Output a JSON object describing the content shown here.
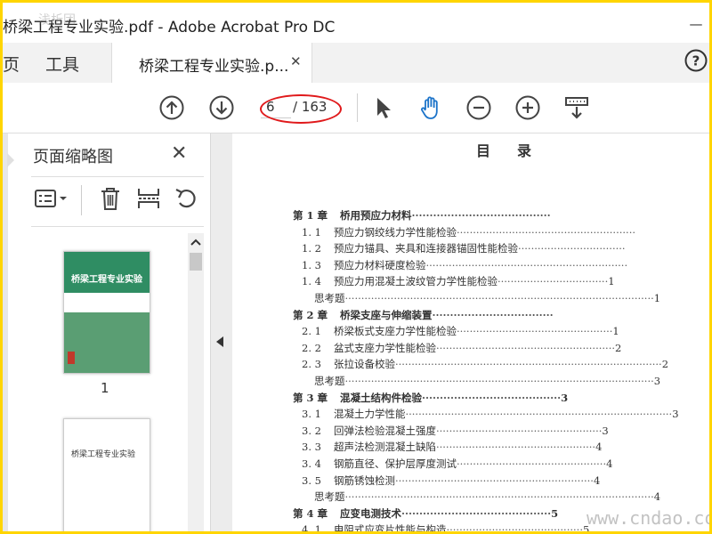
{
  "window": {
    "title": "桥梁工程专业实验.pdf - Adobe Acrobat Pro DC",
    "minimize_glyph": "—",
    "watermark_top": "浅析团"
  },
  "tabs": {
    "home": "页",
    "tools": "工具",
    "document": "桥梁工程专业实验.p...",
    "close_glyph": "✕"
  },
  "toolbar": {
    "current_page": "6",
    "page_total": "/ 163",
    "icons": [
      "up-arrow-icon",
      "down-arrow-icon",
      "select-cursor-icon",
      "hand-tool-icon",
      "zoom-out-icon",
      "zoom-in-icon",
      "read-mode-icon"
    ]
  },
  "sidebar": {
    "title": "页面缩略图",
    "close_glyph": "✕",
    "thumbnails": [
      {
        "page_label": "1",
        "cover_title": "桥梁工程专业实验"
      },
      {
        "cover_title": "桥梁工程专业实验"
      }
    ]
  },
  "document": {
    "heading": "目录",
    "toc": [
      {
        "type": "chapter",
        "num": "第 1 章",
        "title": "桥用预应力材料",
        "leader": "·······································",
        "page": ""
      },
      {
        "type": "sub",
        "num": "1. 1",
        "title": "预应力钢绞线力学性能检验",
        "leader": "·······················································",
        "page": ""
      },
      {
        "type": "sub",
        "num": "1. 2",
        "title": "预应力锚具、夹具和连接器锚固性能检验",
        "leader": "·································",
        "page": ""
      },
      {
        "type": "sub",
        "num": "1. 3",
        "title": "预应力材料硬度检验",
        "leader": "······························································",
        "page": ""
      },
      {
        "type": "sub",
        "num": "1. 4",
        "title": "预应力用混凝土波纹管力学性能检验",
        "leader": "··································",
        "page": "1"
      },
      {
        "type": "sub",
        "num": "",
        "title": "思考题",
        "leader": "·······························································································",
        "page": "1"
      },
      {
        "type": "chapter",
        "num": "第 2 章",
        "title": "桥梁支座与伸缩装置",
        "leader": "··································",
        "page": ""
      },
      {
        "type": "sub",
        "num": "2. 1",
        "title": "桥梁板式支座力学性能检验",
        "leader": "················································",
        "page": "1"
      },
      {
        "type": "sub",
        "num": "2. 2",
        "title": "盆式支座力学性能检验",
        "leader": "·······················································",
        "page": "2"
      },
      {
        "type": "sub",
        "num": "2. 3",
        "title": "张拉设备校验",
        "leader": "··················································································",
        "page": "2"
      },
      {
        "type": "sub",
        "num": "",
        "title": "思考题",
        "leader": "·······························································································",
        "page": "3"
      },
      {
        "type": "chapter",
        "num": "第 3 章",
        "title": "混凝土结构件检验",
        "leader": "·······································",
        "page": "3"
      },
      {
        "type": "sub",
        "num": "3. 1",
        "title": "混凝土力学性能",
        "leader": "··················································································",
        "page": "3"
      },
      {
        "type": "sub",
        "num": "3. 2",
        "title": "回弹法检验混凝土强度",
        "leader": "···················································",
        "page": "3"
      },
      {
        "type": "sub",
        "num": "3. 3",
        "title": "超声法检测混凝土缺陷",
        "leader": "·················································",
        "page": "4"
      },
      {
        "type": "sub",
        "num": "3. 4",
        "title": "钢筋直径、保护层厚度测试",
        "leader": "··············································",
        "page": "4"
      },
      {
        "type": "sub",
        "num": "3. 5",
        "title": "钢筋锈蚀检测",
        "leader": "·····························································",
        "page": "4"
      },
      {
        "type": "sub",
        "num": "",
        "title": "思考题",
        "leader": "·······························································································",
        "page": "4"
      },
      {
        "type": "chapter",
        "num": "第 4 章",
        "title": "应变电测技术",
        "leader": "··········································",
        "page": "5"
      },
      {
        "type": "sub",
        "num": "4. 1",
        "title": "电阻式应变片性能与构造",
        "leader": "··········································",
        "page": "5"
      }
    ]
  },
  "watermark": "www.cndao.com"
}
